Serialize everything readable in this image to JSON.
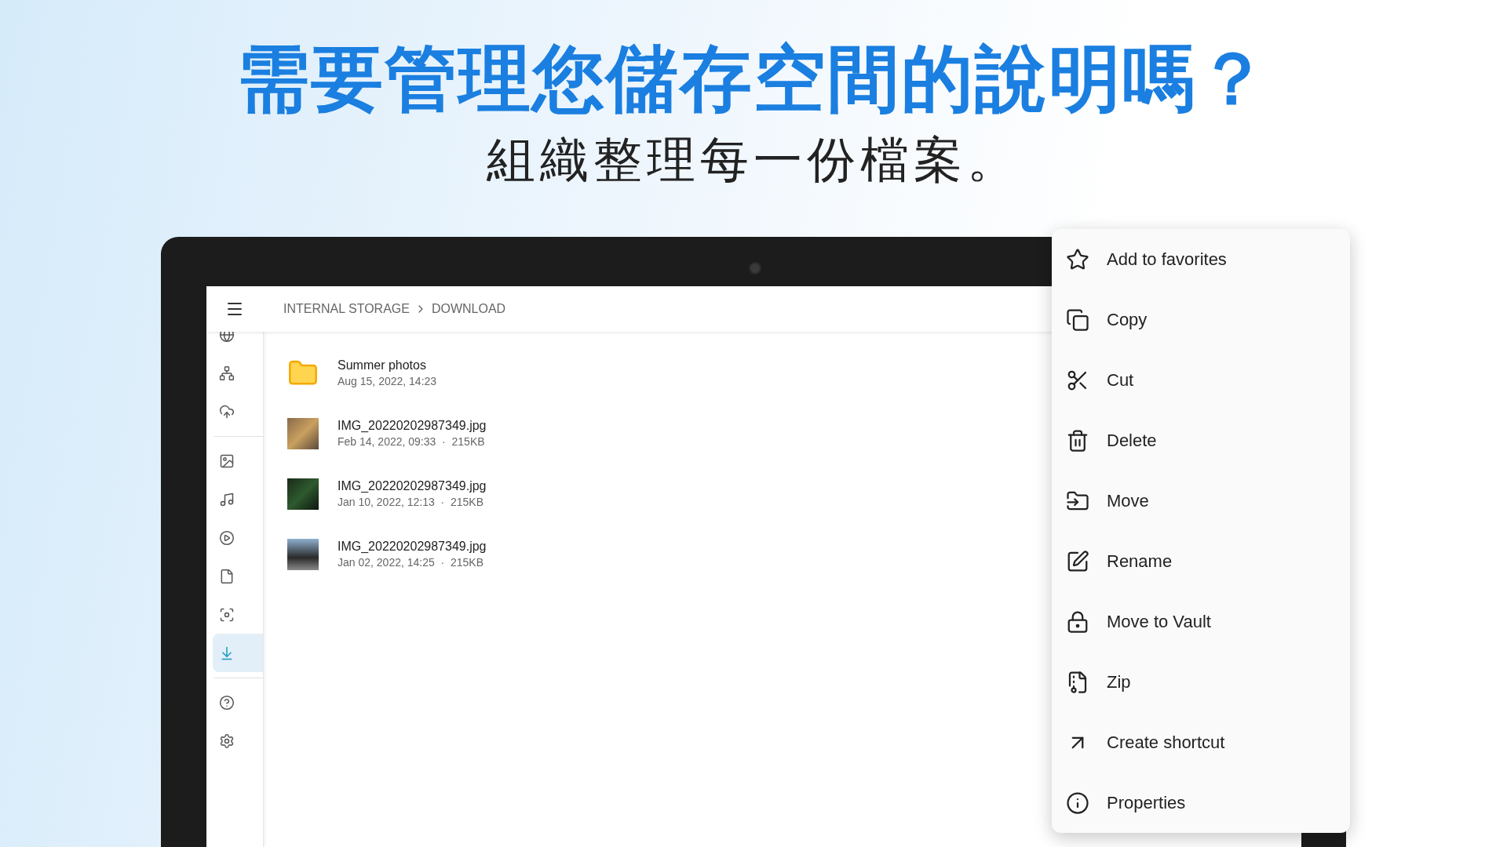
{
  "headline": "需要管理您儲存空間的說明嗎？",
  "subheadline": "組織整理每一份檔案。",
  "toolbar": {
    "breadcrumb": [
      "INTERNAL STORAGE",
      "DOWNLOAD"
    ]
  },
  "sidebar": {
    "groups": [
      [
        {
          "selected": false
        },
        {
          "selected": false
        },
        {
          "selected": false
        }
      ],
      [
        {
          "selected": false
        },
        {
          "selected": false
        },
        {
          "selected": false
        },
        {
          "selected": false
        },
        {
          "selected": false
        },
        {
          "selected": true
        }
      ],
      [
        {
          "selected": false
        },
        {
          "selected": false
        }
      ]
    ]
  },
  "files": [
    {
      "kind": "folder",
      "name": "Summer photos",
      "details": "Aug 15, 2022, 14:23"
    },
    {
      "kind": "image",
      "name": "IMG_20220202987349.jpg",
      "details": "Feb 14, 2022, 09:33  ·  215KB"
    },
    {
      "kind": "image",
      "name": "IMG_20220202987349.jpg",
      "details": "Jan 10, 2022, 12:13  ·  215KB"
    },
    {
      "kind": "image",
      "name": "IMG_20220202987349.jpg",
      "details": "Jan 02, 2022, 14:25  ·  215KB"
    }
  ],
  "context_menu": [
    {
      "label": "Add to favorites"
    },
    {
      "label": "Copy"
    },
    {
      "label": "Cut"
    },
    {
      "label": "Delete"
    },
    {
      "label": "Move"
    },
    {
      "label": "Rename"
    },
    {
      "label": "Move to Vault"
    },
    {
      "label": "Zip"
    },
    {
      "label": "Create shortcut"
    },
    {
      "label": "Properties"
    }
  ]
}
